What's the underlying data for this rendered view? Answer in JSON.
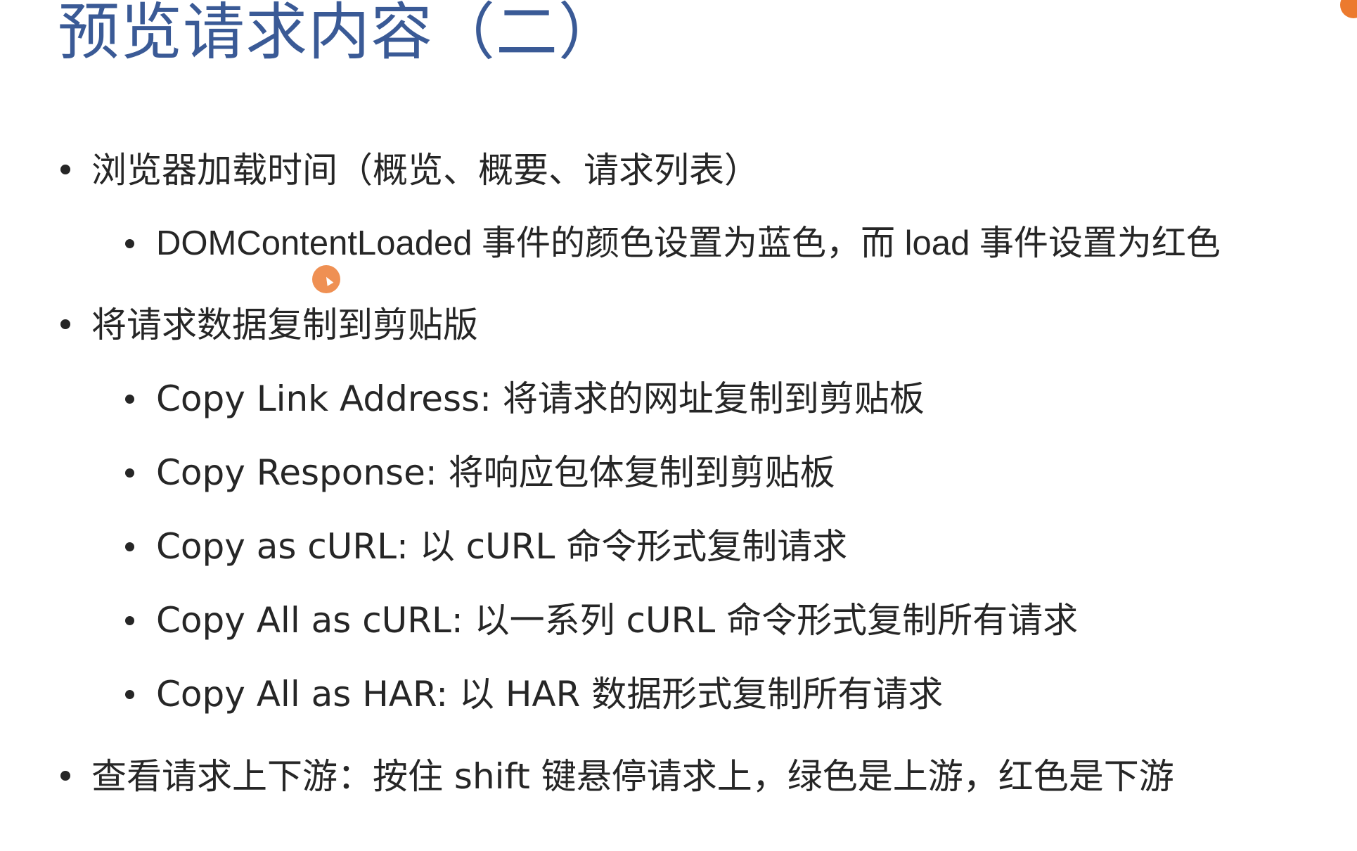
{
  "slide": {
    "title": "预览请求内容（二）",
    "accent_color": "#3a5a96",
    "corner_marker_color": "#ec7a2e",
    "pointer_color": "#ee8a4a"
  },
  "bullets": [
    {
      "level": 1,
      "text": "浏览器加载时间（概览、概要、请求列表）"
    },
    {
      "level": 2,
      "text": "DOMContentLoaded 事件的颜色设置为蓝色，而 load 事件设置为红色"
    },
    {
      "level": 1,
      "text": "将请求数据复制到剪贴版"
    },
    {
      "level": 2,
      "text": "Copy Link Address: 将请求的网址复制到剪贴板"
    },
    {
      "level": 2,
      "text": "Copy Response: 将响应包体复制到剪贴板"
    },
    {
      "level": 2,
      "text": "Copy as cURL: 以 cURL 命令形式复制请求"
    },
    {
      "level": 2,
      "text": "Copy All as cURL: 以一系列 cURL 命令形式复制所有请求"
    },
    {
      "level": 2,
      "text": "Copy All as HAR: 以 HAR 数据形式复制所有请求"
    },
    {
      "level": 1,
      "text": "查看请求上下游：按住 shift 键悬停请求上，绿色是上游，红色是下游"
    }
  ],
  "icons": {
    "bullet": "filled-circle",
    "pointer": "mouse-pointer-highlight"
  }
}
